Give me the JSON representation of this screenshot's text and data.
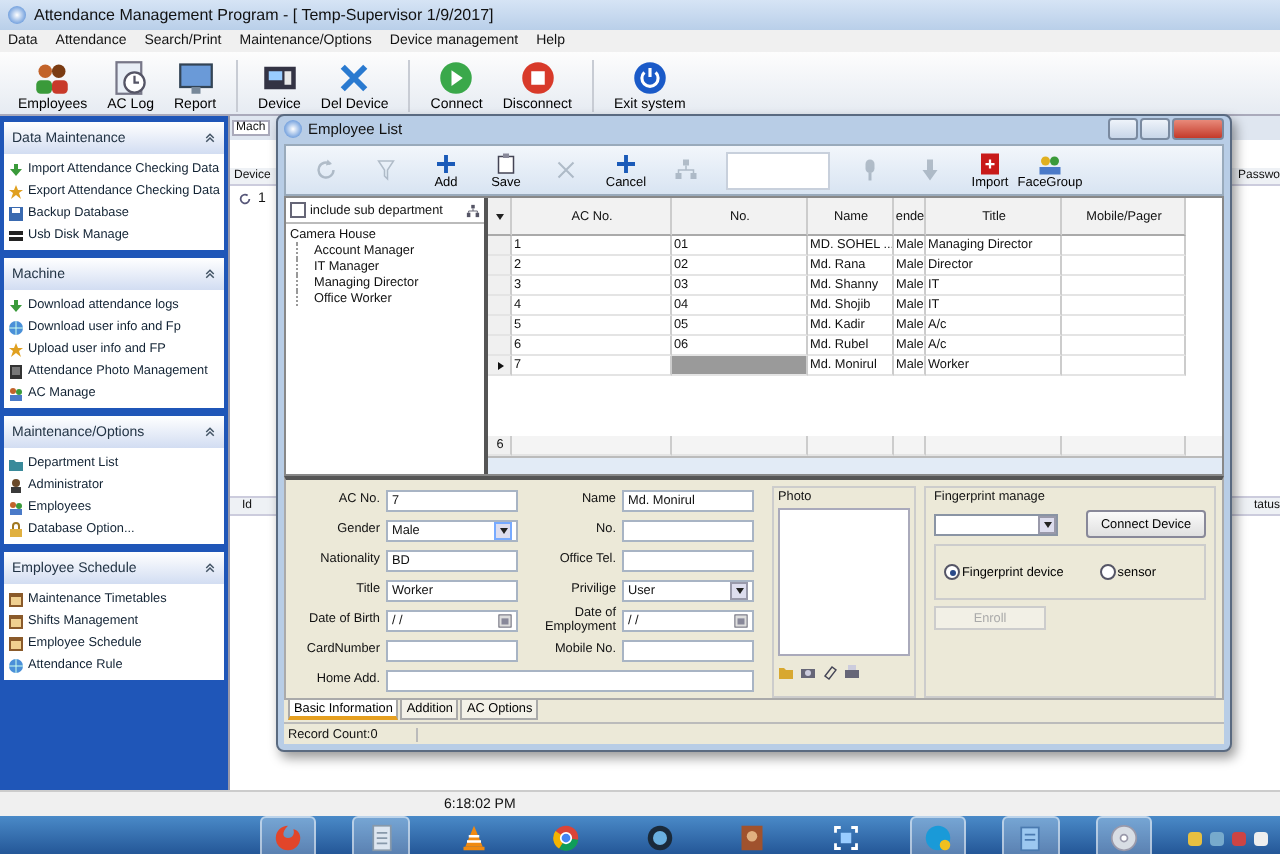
{
  "window": {
    "title": "Attendance Management Program - [ Temp-Supervisor 1/9/2017]"
  },
  "menu": [
    "Data",
    "Attendance",
    "Search/Print",
    "Maintenance/Options",
    "Device management",
    "Help"
  ],
  "toolbar": [
    "Employees",
    "AC Log",
    "Report",
    "Device",
    "Del Device",
    "Connect",
    "Disconnect",
    "Exit system"
  ],
  "sidebar": [
    {
      "title": "Data Maintenance",
      "items": [
        "Import Attendance Checking Data",
        "Export Attendance Checking Data",
        "Backup Database",
        "Usb Disk Manage"
      ]
    },
    {
      "title": "Machine",
      "items": [
        "Download attendance logs",
        "Download user info and Fp",
        "Upload user info and FP",
        "Attendance Photo Management",
        "AC Manage"
      ]
    },
    {
      "title": "Maintenance/Options",
      "items": [
        "Department List",
        "Administrator",
        "Employees",
        "Database Option..."
      ]
    },
    {
      "title": "Employee Schedule",
      "items": [
        "Maintenance Timetables",
        "Shifts Management",
        "Employee Schedule",
        "Attendance Rule"
      ]
    }
  ],
  "background_window": {
    "tab": "Mach",
    "column_1": "Device",
    "row_1": "1",
    "right_column": "Passwo",
    "lower_column_1": "Id",
    "lower_right_column": "tatus"
  },
  "dialog": {
    "title": "Employee List",
    "toolbar": [
      {
        "disabled": true
      },
      {
        "disabled": true
      },
      {
        "label": "Add",
        "disabled": false
      },
      {
        "label": "Save",
        "disabled": false
      },
      {
        "disabled": true
      },
      {
        "label": "Cancel",
        "disabled": false
      },
      {
        "disabled": true
      },
      {
        "kind": "field"
      },
      {
        "disabled": true
      },
      {
        "disabled": true
      },
      {
        "label": "Import",
        "disabled": false
      },
      {
        "label": "FaceGroup",
        "disabled": false
      }
    ],
    "include_sub_department": {
      "label": "include sub department",
      "checked": false
    },
    "tree": {
      "label": "Camera House",
      "children": [
        {
          "label": "Account Manager"
        },
        {
          "label": "IT Manager"
        },
        {
          "label": "Managing Director"
        },
        {
          "label": "Office Worker"
        }
      ]
    },
    "grid": {
      "columns": [
        "AC No.",
        "No.",
        "Name",
        "ende",
        "Title",
        "Mobile/Pager"
      ],
      "rows": [
        {
          "cells": [
            "1",
            "01",
            "MD. SOHEL ...",
            "Male",
            "Managing Director"
          ],
          "current": false
        },
        {
          "cells": [
            "2",
            "02",
            "Md. Rana",
            "Male",
            "Director"
          ],
          "current": false
        },
        {
          "cells": [
            "3",
            "03",
            "Md. Shanny",
            "Male",
            "IT"
          ],
          "current": false
        },
        {
          "cells": [
            "4",
            "04",
            "Md. Shojib",
            "Male",
            "IT"
          ],
          "current": false
        },
        {
          "cells": [
            "5",
            "05",
            "Md. Kadir",
            "Male",
            "A/c"
          ],
          "current": false
        },
        {
          "cells": [
            "6",
            "06",
            "Md. Rubel",
            "Male",
            "A/c"
          ],
          "current": false
        },
        {
          "cells": [
            "7",
            "",
            "Md. Monirul",
            "Male",
            "Worker"
          ],
          "current": true
        }
      ],
      "total": "6"
    },
    "form": {
      "left": [
        {
          "label": "AC No.",
          "value": "7",
          "kind": "text"
        },
        {
          "label": "Gender",
          "value": "Male",
          "kind": "combo"
        },
        {
          "label": "Nationality",
          "value": "BD",
          "kind": "text"
        },
        {
          "label": "Title",
          "value": "Worker",
          "kind": "text"
        },
        {
          "label": "Date of Birth",
          "value": "/ /",
          "kind": "date"
        },
        {
          "label": "CardNumber",
          "kind": "text"
        }
      ],
      "middle": [
        {
          "label": "Name",
          "value": "Md. Monirul",
          "kind": "text"
        },
        {
          "label": "No.",
          "kind": "text"
        },
        {
          "label": "Office Tel.",
          "kind": "text"
        },
        {
          "label": "Privilige",
          "value": "User",
          "kind": "dropdown"
        },
        {
          "label": "Date of Employment",
          "value": "/ /",
          "kind": "date"
        },
        {
          "label": "Mobile No.",
          "kind": "text"
        }
      ],
      "home_address": {
        "label": "Home Add."
      }
    },
    "photo": {
      "label": "Photo"
    },
    "fingerprint": {
      "label": "Fingerprint manage",
      "connect_button": "Connect Device",
      "options": [
        {
          "label": "Fingerprint device",
          "selected": true
        },
        {
          "label": "sensor",
          "selected": false
        }
      ],
      "enroll": {
        "label": "Enroll",
        "disabled": true
      }
    },
    "tabs": [
      {
        "label": "Basic Information",
        "selected": true
      },
      {
        "label": "Addition",
        "selected": false
      },
      {
        "label": "AC Options",
        "selected": false
      }
    ],
    "record_count": "Record Count:0"
  },
  "status_bar": {
    "time": "6:18:02 PM"
  },
  "taskbar": [
    {
      "running": true
    },
    {
      "running": true
    },
    {
      "running": false
    },
    {
      "running": false
    },
    {
      "running": false
    },
    {
      "running": false
    },
    {
      "running": false
    },
    {
      "running": true
    },
    {
      "running": true
    },
    {
      "running": true
    }
  ]
}
